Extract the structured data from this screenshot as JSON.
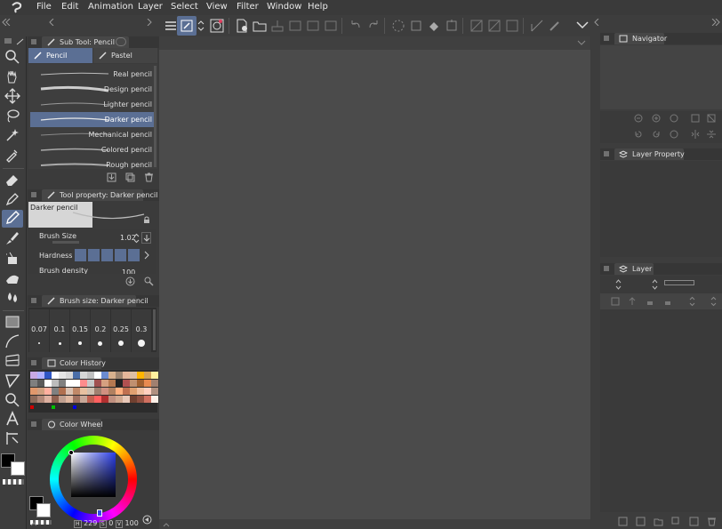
{
  "menu": [
    "File",
    "Edit",
    "Animation",
    "Layer",
    "Select",
    "View",
    "Filter",
    "Window",
    "Help"
  ],
  "subtool": {
    "title": "Sub Tool: Pencil",
    "tabs": [
      "Pencil",
      "Pastel"
    ],
    "brushes": [
      "Real pencil",
      "Design pencil",
      "Lighter pencil",
      "Darker pencil",
      "Mechanical pencil",
      "Colored pencil",
      "Rough pencil"
    ],
    "selected": "Darker pencil"
  },
  "toolprop": {
    "title": "Tool property: Darker pencil",
    "preview_label": "Darker pencil",
    "brush_size_label": "Brush Size",
    "brush_size_value": "1.02",
    "hardness_label": "Hardness",
    "density_label": "Brush density",
    "density_value": "100"
  },
  "brushsize": {
    "title": "Brush size: Darker pencil",
    "sizes": [
      "0.07",
      "0.1",
      "0.15",
      "0.2",
      "0.25",
      "0.3"
    ]
  },
  "colorhistory": {
    "title": "Color History",
    "colors": [
      "#c8a9e4",
      "#b1b1ff",
      "#2e56c4",
      "#ffffff",
      "#e6e6e6",
      "#d8d8d8",
      "#4a6ea8",
      "#d6d6d6",
      "#c0c0c0",
      "#ffffff",
      "#6b8bd1",
      "#d8b18e",
      "#9c8470",
      "#e4b69a",
      "#dcbfa6",
      "#ffb400",
      "#d1a25a",
      "#fff09e",
      "#7f7f7f",
      "#5a5a5a",
      "#ffffff",
      "#bcbcbc",
      "#808080",
      "#ffffff",
      "#ffffff",
      "#ff8c8c",
      "#c8c8c8",
      "#a05050",
      "#d5a080",
      "#b57850",
      "#222222",
      "#b05050",
      "#c09070",
      "#a06030",
      "#e88a50",
      "#a08070",
      "#e0986c",
      "#d0a080",
      "#ffb0a0",
      "#808080",
      "#b07050",
      "#d9c0b0",
      "#c08868",
      "#e8c0a0",
      "#d0c0b0",
      "#a08070",
      "#d09080",
      "#b08060",
      "#ffb080",
      "#c07050",
      "#e0a070",
      "#f0c0a0",
      "#ffd0c0",
      "#b09080",
      "#8c6a5a",
      "#b08878",
      "#ddb0a0",
      "#906050",
      "#c0a090",
      "#e0b8a0",
      "#a07060",
      "#c8a898",
      "#c06050",
      "#ff6060",
      "#b03030",
      "#c09080",
      "#d0a890",
      "#e8c8b8",
      "#704030",
      "#905040",
      "#d07060",
      "#fff0e8"
    ],
    "extra": [
      "#d00000",
      "#00c000",
      "#0000e0"
    ]
  },
  "colorwheel": {
    "title": "Color Wheel",
    "h": "229",
    "s": "0",
    "v": "100",
    "h_label": "H",
    "s_label": "S",
    "v_label": "V"
  },
  "navigator": {
    "title": "Navigator"
  },
  "layerprop": {
    "title": "Layer Property"
  },
  "layer": {
    "title": "Layer"
  }
}
